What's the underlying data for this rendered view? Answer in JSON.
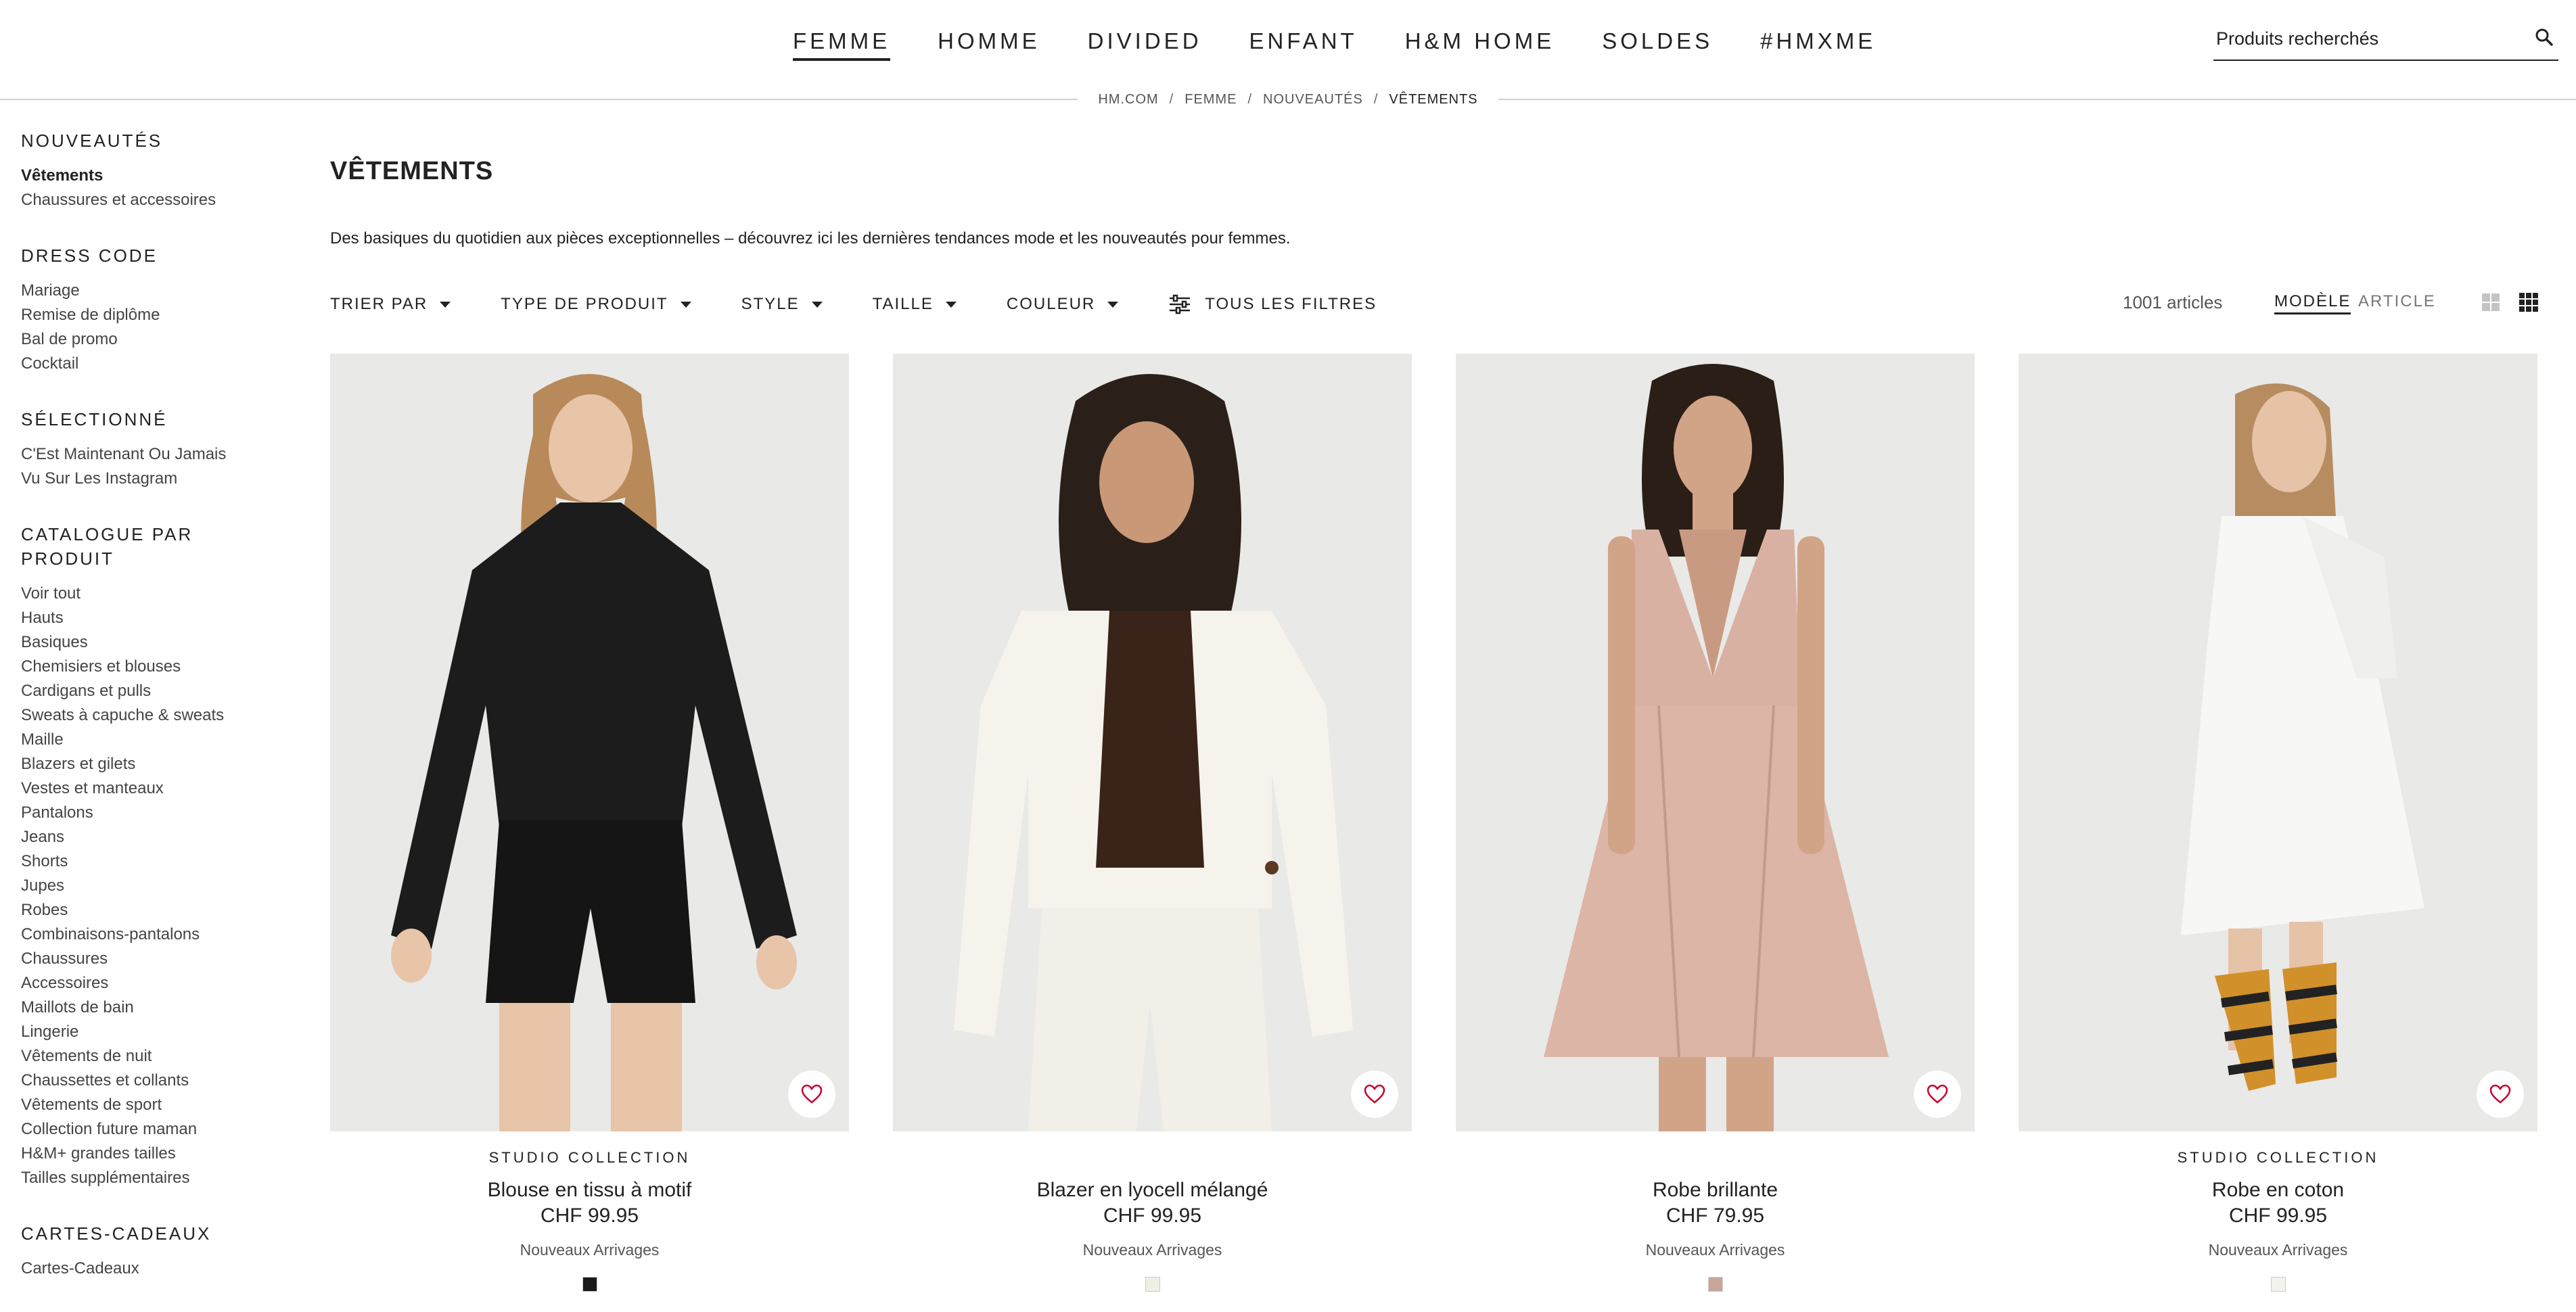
{
  "header": {
    "nav": [
      {
        "label": "FEMME"
      },
      {
        "label": "HOMME"
      },
      {
        "label": "DIVIDED"
      },
      {
        "label": "ENFANT"
      },
      {
        "label": "H&M HOME"
      },
      {
        "label": "SOLDES"
      },
      {
        "label": "#HMXME"
      }
    ],
    "search_placeholder": "Produits recherchés",
    "search_icon": "search-icon"
  },
  "breadcrumb": [
    "HM.COM",
    "FEMME",
    "NOUVEAUTÉS",
    "VÊTEMENTS"
  ],
  "sidebar": {
    "groups": [
      {
        "heading": "NOUVEAUTÉS",
        "items": [
          "Vêtements",
          "Chaussures et accessoires"
        ]
      },
      {
        "heading": "DRESS CODE",
        "items": [
          "Mariage",
          "Remise de diplôme",
          "Bal de promo",
          "Cocktail"
        ]
      },
      {
        "heading": "SÉLECTIONNÉ",
        "items": [
          "C'Est Maintenant Ou Jamais",
          "Vu Sur Les Instagram"
        ]
      },
      {
        "heading": "CATALOGUE PAR PRODUIT",
        "items": [
          "Voir tout",
          "Hauts",
          "Basiques",
          "Chemisiers et blouses",
          "Cardigans et pulls",
          "Sweats à capuche & sweats",
          "Maille",
          "Blazers et gilets",
          "Vestes et manteaux",
          "Pantalons",
          "Jeans",
          "Shorts",
          "Jupes",
          "Robes",
          "Combinaisons-pantalons",
          "Chaussures",
          "Accessoires",
          "Maillots de bain",
          "Lingerie",
          "Vêtements de nuit",
          "Chaussettes et collants",
          "Vêtements de sport",
          "Collection future maman",
          "H&M+ grandes tailles",
          "Tailles supplémentaires"
        ]
      },
      {
        "heading": "CARTES-CADEAUX",
        "items": [
          "Cartes-Cadeaux"
        ]
      }
    ]
  },
  "main": {
    "title": "VÊTEMENTS",
    "description": "Des basiques du quotidien aux pièces exceptionnelles – découvrez ici les dernières tendances mode et les nouveautés pour femmes.",
    "filters": {
      "sort": "TRIER PAR",
      "product_type": "TYPE DE PRODUIT",
      "style": "STYLE",
      "size": "TAILLE",
      "color": "COULEUR",
      "all_filters": "TOUS LES FILTRES"
    },
    "count": "1001 articles",
    "view_model": "MODÈLE",
    "view_article": "ARTICLE"
  },
  "products": [
    {
      "brand": "STUDIO COLLECTION",
      "name": "Blouse en tissu à motif",
      "price": "CHF 99.95",
      "tag": "Nouveaux Arrivages",
      "swatch": "#1a1a1a"
    },
    {
      "brand": "",
      "name": "Blazer en lyocell mélangé",
      "price": "CHF 99.95",
      "tag": "Nouveaux Arrivages",
      "swatch": "#f0efe6"
    },
    {
      "brand": "",
      "name": "Robe brillante",
      "price": "CHF 79.95",
      "tag": "Nouveaux Arrivages",
      "swatch": "#c8a79a"
    },
    {
      "brand": "STUDIO COLLECTION",
      "name": "Robe en coton",
      "price": "CHF 99.95",
      "tag": "Nouveaux Arrivages",
      "swatch": "#f2f2ef"
    }
  ],
  "colors": {
    "text": "#222222",
    "favorite_heart": "#c9002b",
    "divider": "#d0d0d0"
  }
}
